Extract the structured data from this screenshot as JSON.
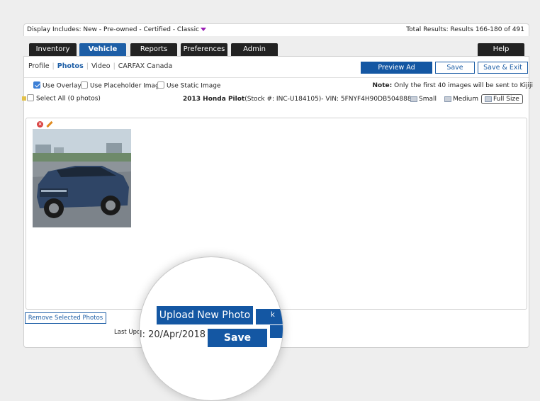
{
  "info_bar": {
    "display_includes": "Display Includes: New - Pre-owned - Certified - Classic",
    "total_results": "Total Results: Results 166-180 of 491"
  },
  "nav": {
    "tabs": [
      "Inventory",
      "Vehicle",
      "Reports",
      "Preferences",
      "Admin"
    ],
    "active": "Vehicle",
    "help": "Help"
  },
  "subtabs": {
    "items": [
      "Profile",
      "Photos",
      "Video",
      "CARFAX Canada"
    ],
    "active": "Photos"
  },
  "actions": {
    "preview_ad": "Preview Ad",
    "save": "Save",
    "save_exit": "Save & Exit"
  },
  "options": {
    "use_overlay": "Use Overlay",
    "use_overlay_checked": true,
    "use_placeholder": "Use Placeholder Image",
    "use_static": "Use Static Image",
    "note_label": "Note:",
    "note_text": "Only the first 40 images will be sent to Kijiji"
  },
  "select_row": {
    "select_all": "Select All (0 photos)",
    "vehicle_title": "2013 Honda Pilot",
    "vehicle_details": "(Stock #: INC-U184105)- VIN: 5FNYF4H90DB504888",
    "size_small": "Small",
    "size_medium": "Medium",
    "size_full": "Full Size"
  },
  "photos": {
    "count_shown": 1
  },
  "footer": {
    "remove_selected": "Remove Selected Photos",
    "last_updated_prefix": "Last Upda"
  },
  "lens": {
    "upload_new_photo": "Upload New Photo",
    "stub_glyph": "k",
    "date_text": "l: 20/Apr/2018",
    "save": "Save"
  },
  "colors": {
    "brand_blue": "#1457a3",
    "nav_dark": "#222222",
    "caret_purple": "#9b1fb5"
  }
}
